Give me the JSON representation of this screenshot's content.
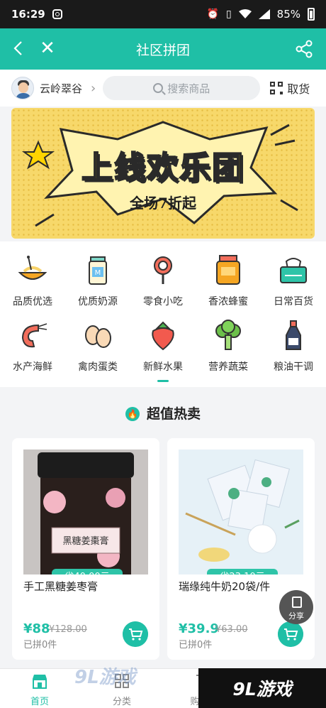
{
  "status_bar": {
    "time": "16:29",
    "battery": "85%"
  },
  "nav": {
    "title": "社区拼团"
  },
  "header": {
    "community": "云岭翠谷",
    "search_placeholder": "搜索商品",
    "pickup_label": "取货"
  },
  "banner": {
    "headline": "上线欢乐团",
    "subline": "全场7折起"
  },
  "categories": [
    {
      "label": "品质优选",
      "icon": "pasta-bowl-icon"
    },
    {
      "label": "优质奶源",
      "icon": "milk-icon"
    },
    {
      "label": "零食小吃",
      "icon": "lollipop-icon"
    },
    {
      "label": "香浓蜂蜜",
      "icon": "honey-jar-icon"
    },
    {
      "label": "日常百货",
      "icon": "tissue-box-icon"
    },
    {
      "label": "水产海鲜",
      "icon": "shrimp-icon"
    },
    {
      "label": "禽肉蛋类",
      "icon": "eggs-icon"
    },
    {
      "label": "新鲜水果",
      "icon": "strawberry-icon"
    },
    {
      "label": "营养蔬菜",
      "icon": "broccoli-icon"
    },
    {
      "label": "粮油干调",
      "icon": "soy-sauce-icon"
    }
  ],
  "hot": {
    "title": "超值热卖"
  },
  "products": [
    {
      "name": "手工黑糖姜枣膏",
      "save": "省40.00元",
      "price": "¥88",
      "original": "¥128.00",
      "sold": "已拼0件",
      "jar_label": "黑糖姜棗膏"
    },
    {
      "name": "瑞缘纯牛奶20袋/件",
      "save": "省23.10元",
      "price": "¥39.9",
      "original": "¥63.00",
      "sold": "已拼0件"
    }
  ],
  "share_float": {
    "label": "分享"
  },
  "tabs": [
    {
      "label": "首页",
      "icon": "store-icon",
      "active": true
    },
    {
      "label": "分类",
      "icon": "grid-icon",
      "active": false
    },
    {
      "label": "购物车",
      "icon": "cart-icon",
      "active": false
    }
  ],
  "watermark": {
    "left": "9L游戏",
    "right": "9L游戏"
  },
  "colors": {
    "primary": "#1fbfa6",
    "banner": "#f7d86a"
  }
}
